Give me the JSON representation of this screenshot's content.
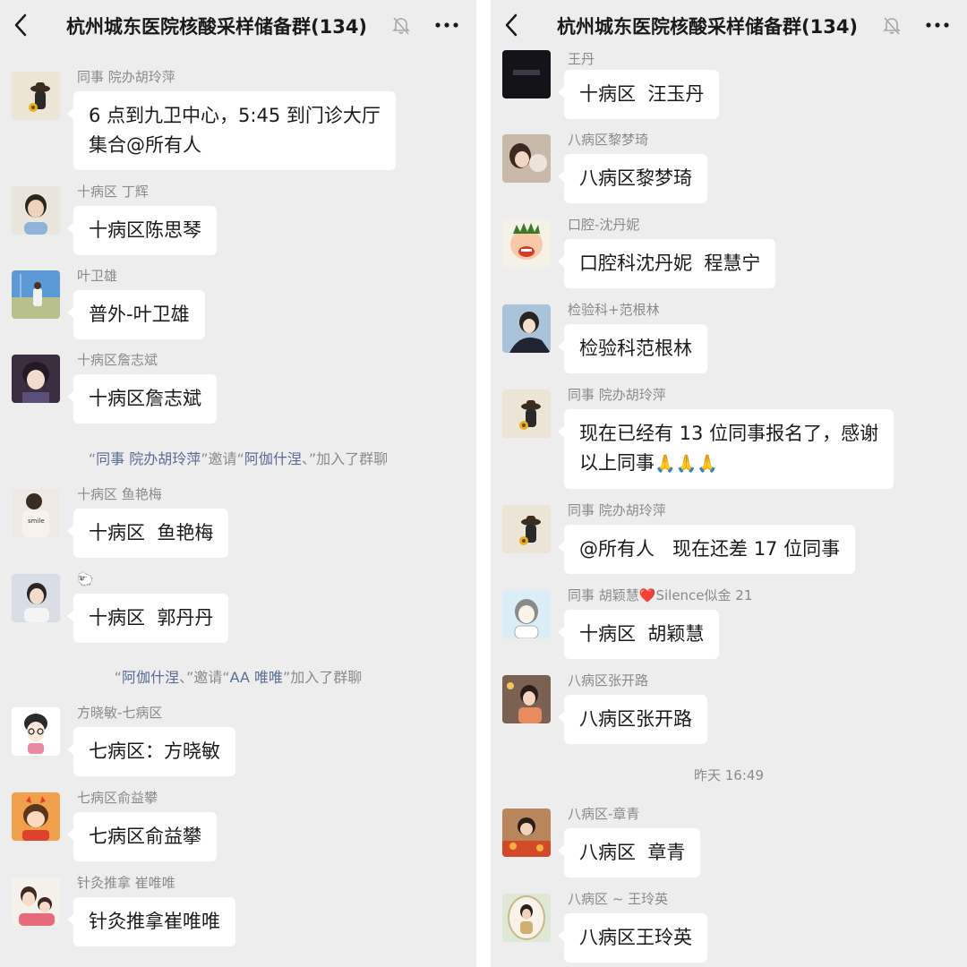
{
  "title": "杭州城东医院核酸采样储备群(134)",
  "left": {
    "messages": [
      {
        "nick": "同事 院办胡玲萍",
        "text": "6 点到九卫中心，5:45 到门诊大厅\n集合@所有人"
      },
      {
        "nick": "十病区 丁辉",
        "text": "十病区陈思琴"
      },
      {
        "nick": "叶卫雄",
        "text": "普外-叶卫雄"
      },
      {
        "nick": "十病区詹志斌",
        "text": "十病区詹志斌"
      },
      {
        "nick": "十病区 鱼艳梅",
        "text": "十病区  鱼艳梅"
      },
      {
        "nick": "🐑",
        "text": "十病区  郭丹丹"
      },
      {
        "nick": "方晓敏-七病区",
        "text": "七病区：方晓敏"
      },
      {
        "nick": "七病区俞益攀",
        "text": "七病区俞益攀"
      },
      {
        "nick": "针灸推拿  崔唯唯",
        "text": "针灸推拿崔唯唯"
      }
    ],
    "sys1": {
      "q1": "“",
      "n1": "同事 院办胡玲萍",
      "mid": "”邀请“",
      "n2": "阿伽什涅",
      "end": "、”加入了群聊"
    },
    "sys2": {
      "q1": "“",
      "n1": "阿伽什涅",
      "mid": "、”邀请“",
      "n2": "AA 唯唯",
      "end": "”加入了群聊"
    }
  },
  "right": {
    "messages": [
      {
        "nick": "王丹",
        "text": "十病区  汪玉丹"
      },
      {
        "nick": "八病区黎梦琦",
        "text": "八病区黎梦琦"
      },
      {
        "nick": "口腔-沈丹妮",
        "text": "口腔科沈丹妮  程慧宁"
      },
      {
        "nick": "检验科+范根林",
        "text": "检验科范根林"
      },
      {
        "nick": "同事 院办胡玲萍",
        "text": "现在已经有 13 位同事报名了，感谢\n以上同事",
        "emoji": "🙏🙏🙏"
      },
      {
        "nick": "同事 院办胡玲萍",
        "text": "@所有人   现在还差 17 位同事"
      },
      {
        "nick": "同事 胡颖慧",
        "nick_heart": "❤️",
        "nick_tail": "Silence似金 21",
        "text": "十病区  胡颖慧"
      },
      {
        "nick": "八病区张开路",
        "text": "八病区张开路"
      },
      {
        "nick": "八病区-章青",
        "text": "八病区  章青"
      },
      {
        "nick": "八病区 ~ 王玲英",
        "text": "八病区王玲英"
      }
    ],
    "time": "昨天 16:49"
  }
}
